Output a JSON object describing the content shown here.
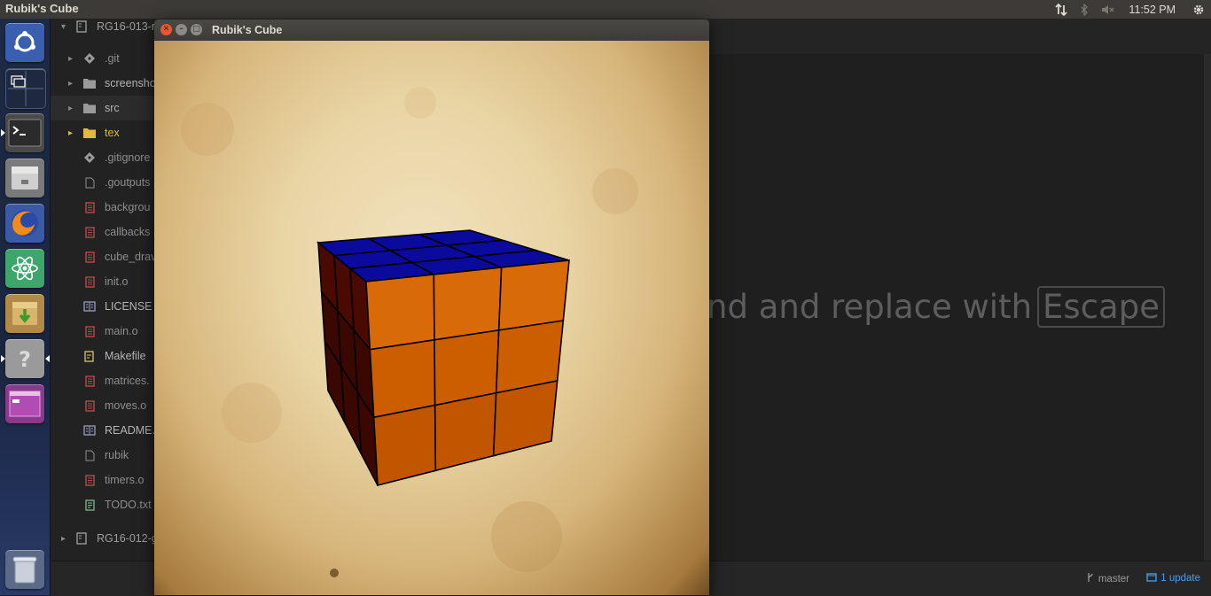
{
  "topbar": {
    "app_title": "Rubik's Cube",
    "clock": "11:52 PM"
  },
  "launcher": {
    "items": [
      {
        "name": "ubuntu-dash-icon"
      },
      {
        "name": "workspace-switcher-icon"
      },
      {
        "name": "terminal-icon"
      },
      {
        "name": "files-icon"
      },
      {
        "name": "firefox-icon"
      },
      {
        "name": "atom-icon"
      },
      {
        "name": "archive-manager-icon"
      },
      {
        "name": "help-icon"
      },
      {
        "name": "window-app-icon"
      },
      {
        "name": "trash-icon"
      }
    ]
  },
  "tree": {
    "project1": "RG16-013-r",
    "items": [
      {
        "label": ".git",
        "type": "git"
      },
      {
        "label": "screensho",
        "type": "folder"
      },
      {
        "label": "src",
        "type": "folder"
      },
      {
        "label": "tex",
        "type": "folder"
      },
      {
        "label": ".gitignore",
        "type": "git"
      },
      {
        "label": ".goutputs",
        "type": "file"
      },
      {
        "label": "backgrou",
        "type": "binary"
      },
      {
        "label": "callbacks",
        "type": "binary"
      },
      {
        "label": "cube_drav",
        "type": "binary"
      },
      {
        "label": "init.o",
        "type": "binary"
      },
      {
        "label": "LICENSE",
        "type": "book"
      },
      {
        "label": "main.o",
        "type": "binary"
      },
      {
        "label": "Makefile",
        "type": "makefile"
      },
      {
        "label": "matrices.",
        "type": "binary"
      },
      {
        "label": "moves.o",
        "type": "binary"
      },
      {
        "label": "README.",
        "type": "book"
      },
      {
        "label": "rubik",
        "type": "file"
      },
      {
        "label": "timers.o",
        "type": "binary"
      },
      {
        "label": "TODO.txt",
        "type": "text"
      }
    ],
    "project2": "RG16-012-g"
  },
  "pane": {
    "hint_text": "nd and replace with",
    "hint_key": "Escape"
  },
  "statusbar": {
    "branch": "master",
    "update": "1 update"
  },
  "window": {
    "title": "Rubik's Cube"
  },
  "cube": {
    "top_color": "#0a0a9c",
    "front_color": "#cc5e00",
    "side_color": "#3a0800",
    "grid_color": "#000000"
  }
}
